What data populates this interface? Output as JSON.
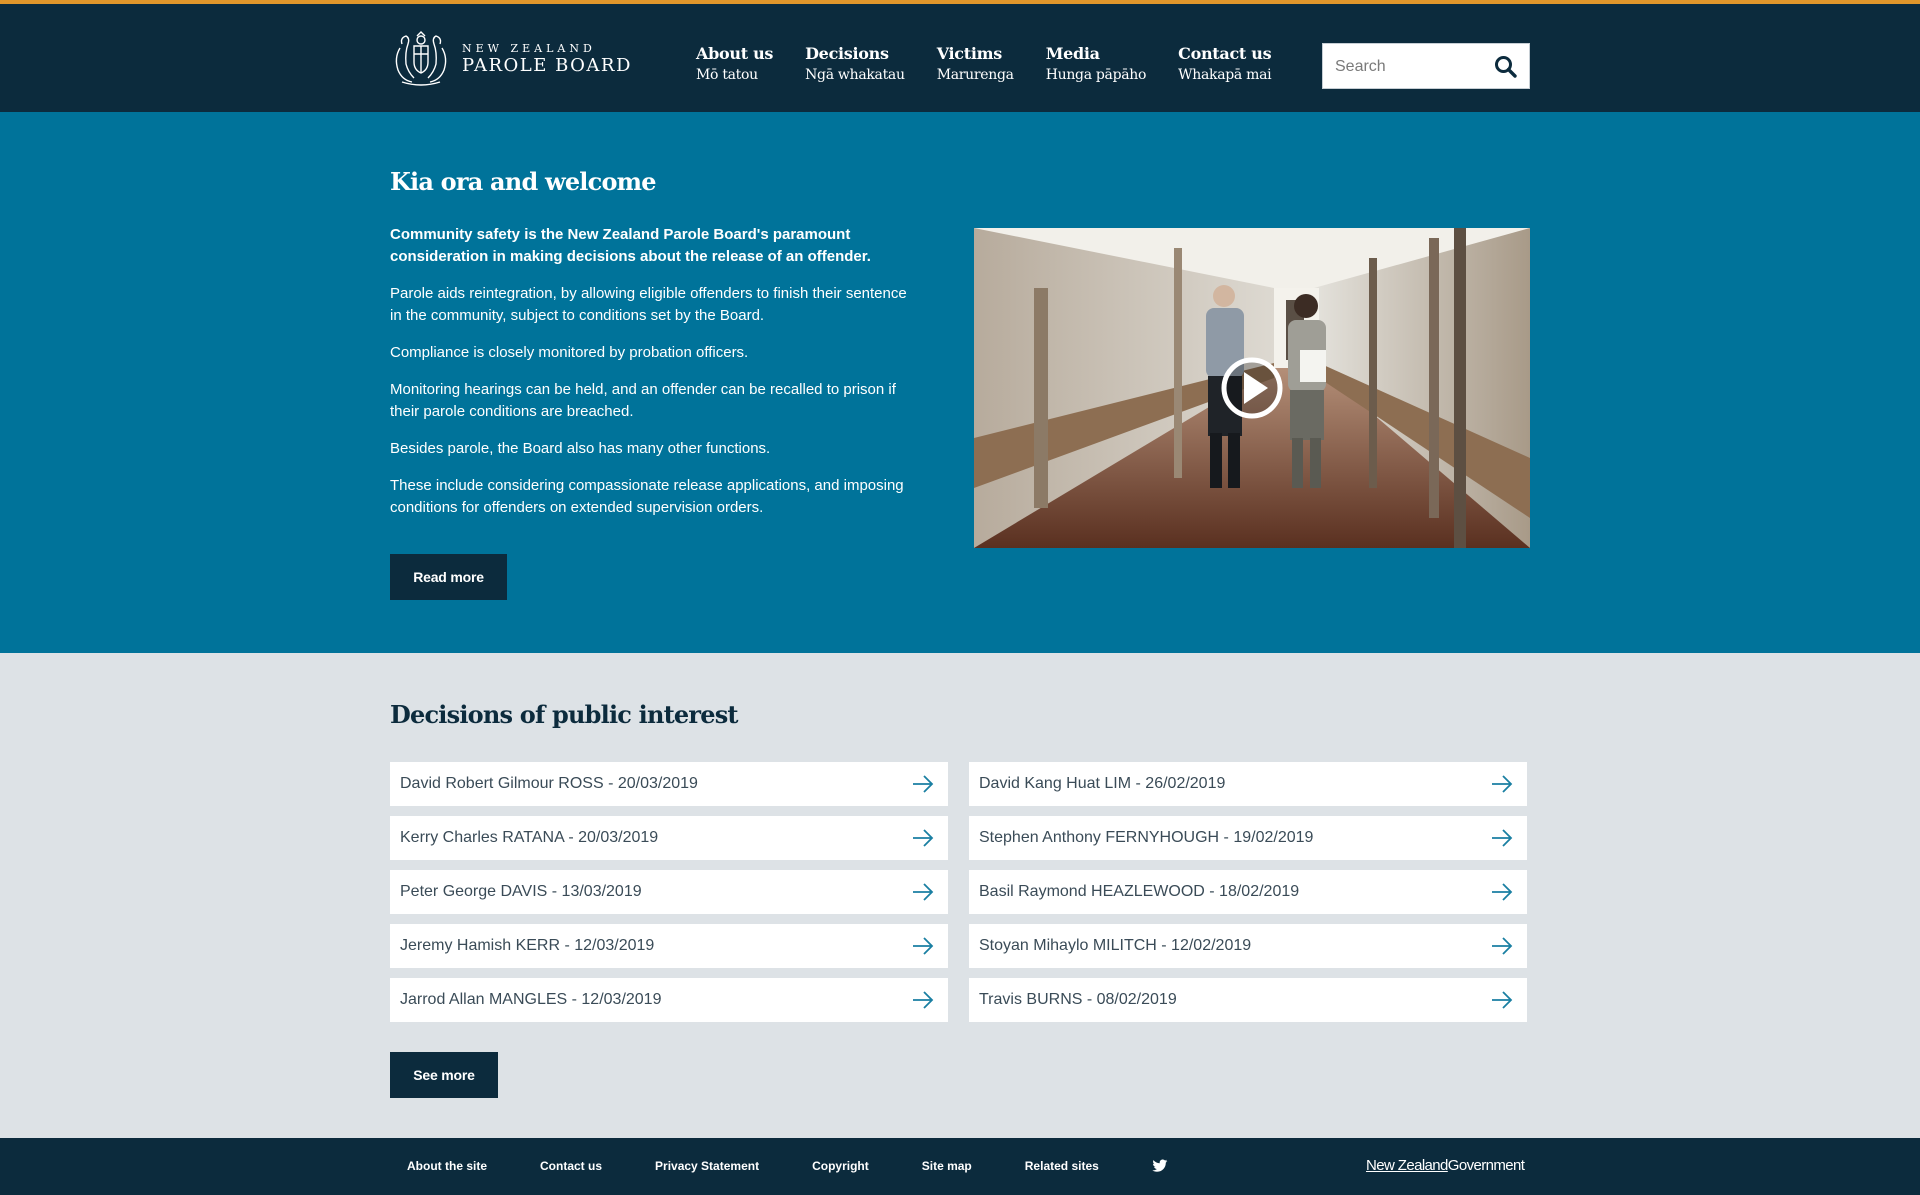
{
  "header": {
    "logo": {
      "line1": "NEW ZEALAND",
      "line2": "PAROLE BOARD"
    },
    "nav": [
      {
        "en": "About us",
        "mi": "Mō tatou"
      },
      {
        "en": "Decisions",
        "mi": "Ngā whakatau"
      },
      {
        "en": "Victims",
        "mi": "Marurenga"
      },
      {
        "en": "Media",
        "mi": "Hunga pāpāho"
      },
      {
        "en": "Contact us",
        "mi": "Whakapā mai"
      }
    ],
    "search": {
      "placeholder": "Search",
      "icon": "search-icon"
    },
    "accent_color": "#e0962b",
    "background_color": "#0c2b3d"
  },
  "hero": {
    "title": "Kia ora and welcome",
    "lead": "Community safety is the New Zealand Parole Board's paramount consideration in making decisions about the release of an offender.",
    "paragraphs": [
      "Parole aids reintegration, by allowing eligible offenders to finish their sentence in the community, subject to conditions set by the Board.",
      "Compliance is closely monitored by probation officers.",
      "Monitoring hearings can be held, and an offender can be recalled to prison if their parole conditions are breached.",
      "Besides parole, the Board also has many other functions.",
      "These include considering compassionate release applications, and imposing conditions for offenders on extended supervision orders."
    ],
    "read_more": "Read more",
    "video": {
      "icon": "play-icon"
    },
    "background_color": "#00739a"
  },
  "decisions": {
    "title": "Decisions of public interest",
    "left": [
      "David Robert Gilmour ROSS - 20/03/2019",
      "Kerry Charles RATANA - 20/03/2019",
      "Peter George DAVIS - 13/03/2019",
      "Jeremy Hamish KERR - 12/03/2019",
      "Jarrod Allan MANGLES - 12/03/2019"
    ],
    "right": [
      "David Kang Huat LIM - 26/02/2019",
      "Stephen Anthony FERNYHOUGH - 19/02/2019",
      "Basil Raymond HEAZLEWOOD - 18/02/2019",
      "Stoyan Mihaylo MILITCH - 12/02/2019",
      "Travis BURNS - 08/02/2019"
    ],
    "see_more": "See more",
    "arrow_icon": "arrow-right-icon"
  },
  "footer": {
    "links": [
      "About the site",
      "Contact us",
      "Privacy Statement",
      "Copyright",
      "Site map",
      "Related sites"
    ],
    "twitter_icon": "twitter-icon",
    "gov_logo": {
      "part1": "New Zealand",
      "part2": "Government"
    }
  }
}
